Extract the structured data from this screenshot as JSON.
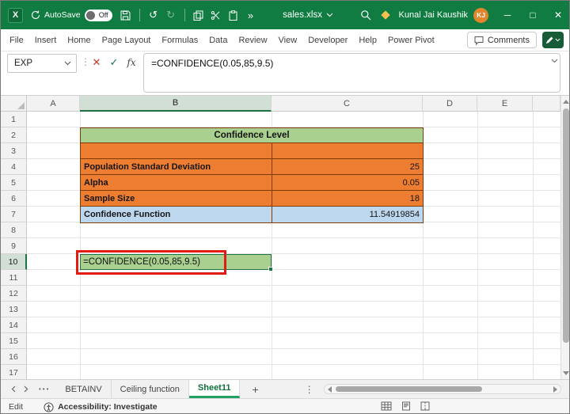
{
  "titlebar": {
    "app_logo": "X",
    "autosave_label": "AutoSave",
    "autosave_state": "Off",
    "document_name": "sales.xlsx",
    "user_name": "Kunal Jai Kaushik",
    "user_initials": "KJ"
  },
  "ribbon": {
    "tabs": [
      "File",
      "Insert",
      "Home",
      "Page Layout",
      "Formulas",
      "Data",
      "Review",
      "View",
      "Developer",
      "Help",
      "Power Pivot"
    ],
    "comments_label": "Comments"
  },
  "formula_bar": {
    "name_box_value": "EXP",
    "formula": "=CONFIDENCE(0.05,85,9.5)"
  },
  "grid": {
    "column_headers": [
      "A",
      "B",
      "C",
      "D",
      "E"
    ],
    "row_headers": [
      "1",
      "2",
      "3",
      "4",
      "5",
      "6",
      "7",
      "8",
      "9",
      "10",
      "11",
      "12",
      "13",
      "14",
      "15",
      "16",
      "17"
    ],
    "selected_column": "B",
    "selected_row": "10"
  },
  "worksheet": {
    "table_title": "Confidence Level",
    "rows": [
      {
        "label": "Population Standard Deviation",
        "value": "25"
      },
      {
        "label": "Alpha",
        "value": "0.05"
      },
      {
        "label": "Sample Size",
        "value": "18"
      },
      {
        "label": "Confidence Function",
        "value": "11.54919854"
      }
    ],
    "active_cell_text": "=CONFIDENCE(0.05,85,9.5)"
  },
  "sheet_bar": {
    "tabs": [
      "BETAINV",
      "Ceiling function",
      "Sheet11"
    ],
    "active_tab": "Sheet11"
  },
  "status_bar": {
    "mode": "Edit",
    "accessibility_text": "Accessibility: Investigate"
  },
  "icons": {
    "undo": "↺",
    "redo": "↻",
    "overflow": "»",
    "dots": "⋮",
    "cancel": "✕",
    "check": "✓",
    "fx": "fx",
    "minimize": "─",
    "maximize": "□",
    "close": "✕",
    "tab_ellipsis": "•••",
    "add_sheet": "+"
  },
  "colors": {
    "titlebar_green": "#107C41",
    "accent_green": "#21A366",
    "table_orange": "#ED7D31",
    "header_green": "#A9D08E",
    "result_blue": "#BDD7EE",
    "table_border": "#7E3B04",
    "annotation_red": "#E21B12"
  }
}
